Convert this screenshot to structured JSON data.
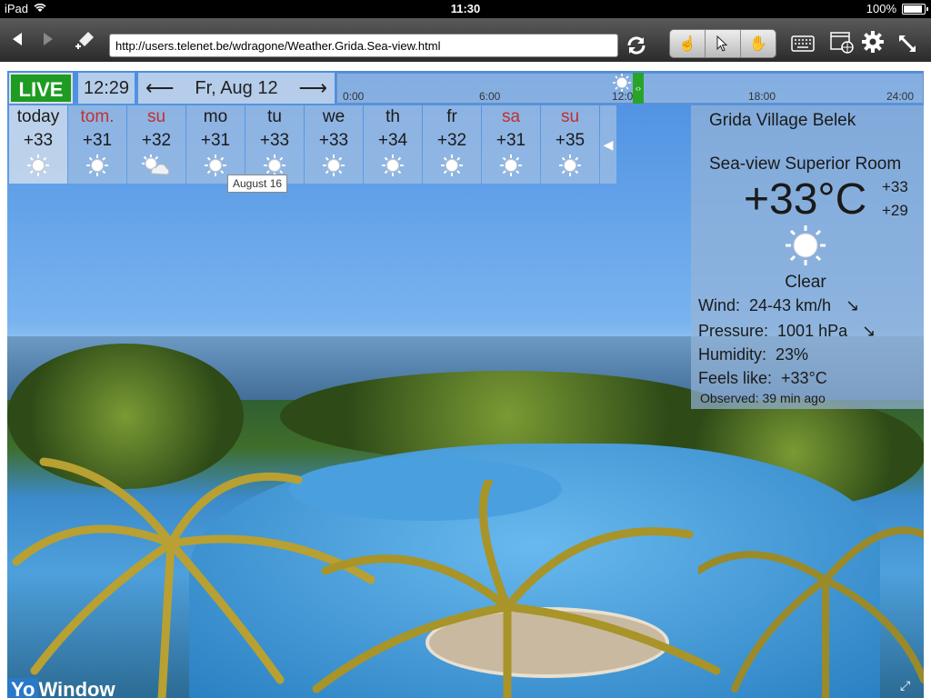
{
  "status": {
    "device": "iPad",
    "time": "11:30",
    "battery": "100%"
  },
  "browser": {
    "url": "http://users.telenet.be/wdragone/Weather.Grida.Sea-view.html"
  },
  "weather": {
    "live_label": "LIVE",
    "time": "12:29",
    "date": "Fr, Aug 12",
    "timeline_ticks": [
      "0:00",
      "6:00",
      "12:00",
      "18:00",
      "24:00"
    ],
    "days": [
      {
        "name": "today",
        "temp": "+33",
        "icon": "sun-icon",
        "weekend": false
      },
      {
        "name": "tom.",
        "temp": "+31",
        "icon": "sun-icon",
        "weekend": true
      },
      {
        "name": "su",
        "temp": "+32",
        "icon": "sun-cloud-icon",
        "weekend": true
      },
      {
        "name": "mo",
        "temp": "+31",
        "icon": "sun-icon",
        "weekend": false
      },
      {
        "name": "tu",
        "temp": "+33",
        "icon": "sun-icon",
        "weekend": false
      },
      {
        "name": "we",
        "temp": "+33",
        "icon": "sun-icon",
        "weekend": false
      },
      {
        "name": "th",
        "temp": "+34",
        "icon": "sun-icon",
        "weekend": false
      },
      {
        "name": "fr",
        "temp": "+32",
        "icon": "sun-icon",
        "weekend": false
      },
      {
        "name": "sa",
        "temp": "+31",
        "icon": "sun-icon",
        "weekend": true
      },
      {
        "name": "su",
        "temp": "+35",
        "icon": "sun-icon",
        "weekend": true
      }
    ],
    "tooltip": "August 16",
    "panel": {
      "location": "Grida Village Belek",
      "room": "Sea-view Superior Room",
      "temperature": "+33°C",
      "high": "+33",
      "low": "+29",
      "condition": "Clear",
      "wind_label": "Wind:",
      "wind_value": "24-43 km/h",
      "pressure_label": "Pressure:",
      "pressure_value": "1001 hPa",
      "humidity_label": "Humidity:",
      "humidity_value": "23%",
      "feels_label": "Feels like:",
      "feels_value": "+33°C",
      "observed_label": "Observed:",
      "observed_value": "39 min ago"
    },
    "brand": "YoWindow"
  }
}
